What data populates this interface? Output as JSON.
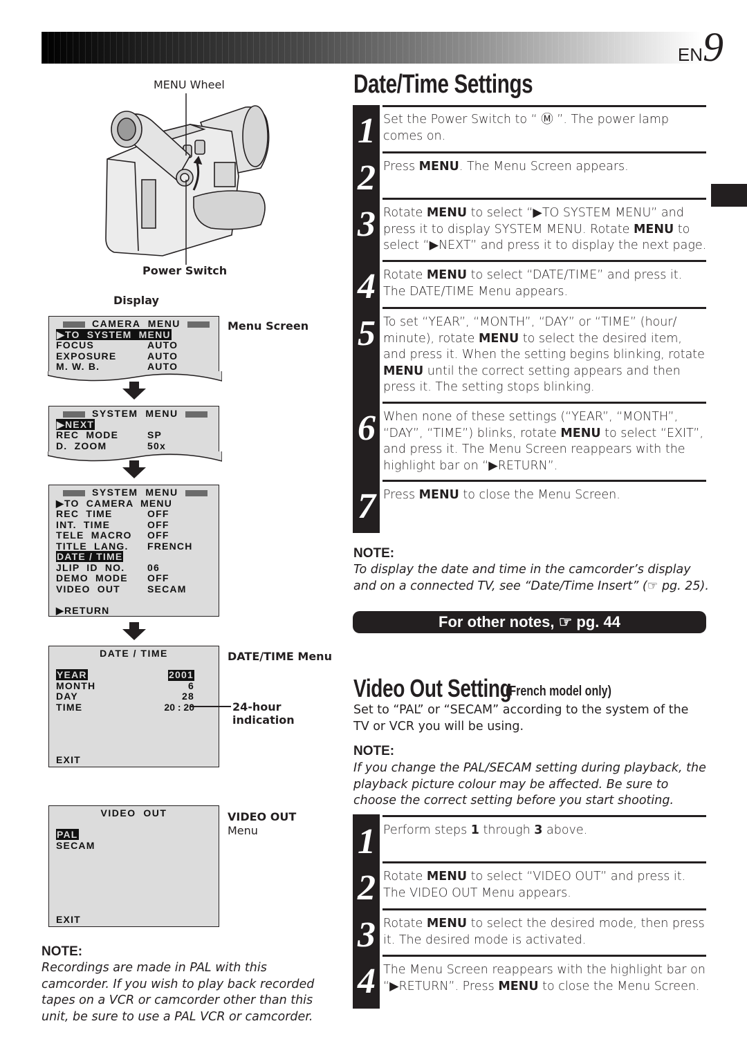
{
  "header": {
    "page_prefix": "EN",
    "page_number": "9"
  },
  "illustration": {
    "menu_wheel_label": "MENU Wheel",
    "power_switch_label": "Power Switch",
    "display_label": "Display"
  },
  "screens": {
    "menu_screen_label": "Menu Screen",
    "camera_menu": {
      "title": "CAMERA  MENU",
      "rows": [
        {
          "label": "▶TO  SYSTEM  MENU",
          "value": "",
          "highlight": true
        },
        {
          "label": "FOCUS",
          "value": "AUTO"
        },
        {
          "label": "EXPOSURE",
          "value": "AUTO"
        },
        {
          "label": "M. W. B.",
          "value": "AUTO"
        }
      ]
    },
    "system_menu_1": {
      "title": "SYSTEM  MENU",
      "rows": [
        {
          "label": "▶NEXT",
          "value": "",
          "highlight": true
        },
        {
          "label": "REC  MODE",
          "value": "SP"
        },
        {
          "label": "D.  ZOOM",
          "value": "50x"
        }
      ]
    },
    "system_menu_2": {
      "title": "SYSTEM  MENU",
      "rows": [
        {
          "label": "▶TO  CAMERA  MENU",
          "value": ""
        },
        {
          "label": "REC  TIME",
          "value": "OFF"
        },
        {
          "label": "INT.  TIME",
          "value": "OFF"
        },
        {
          "label": "TELE  MACRO",
          "value": "OFF"
        },
        {
          "label": "TITLE  LANG.",
          "value": "FRENCH"
        },
        {
          "label": "DATE / TIME",
          "value": "",
          "highlight": true
        },
        {
          "label": "JLIP  ID  NO.",
          "value": "06"
        },
        {
          "label": "DEMO  MODE",
          "value": "OFF"
        },
        {
          "label": "VIDEO  OUT",
          "value": "SECAM"
        }
      ],
      "footer": "▶RETURN"
    },
    "date_time_menu": {
      "label": "DATE/TIME Menu",
      "title": "DATE / TIME",
      "rows": [
        {
          "label": "YEAR",
          "value": "2001",
          "highlight": true
        },
        {
          "label": "MONTH",
          "value": "6"
        },
        {
          "label": "DAY",
          "value": "28"
        },
        {
          "label": "TIME",
          "value": "20 : 20"
        }
      ],
      "exit": "EXIT",
      "callout_line1": "24-hour",
      "callout_line2": "indication"
    },
    "video_out_menu": {
      "label_line1": "VIDEO OUT",
      "label_line2": "Menu",
      "title": "VIDEO  OUT",
      "options": [
        {
          "label": "PAL",
          "highlight": true
        },
        {
          "label": "SECAM"
        }
      ],
      "exit": "EXIT"
    }
  },
  "left_note": {
    "label": "NOTE:",
    "text": "Recordings are made in PAL with this camcorder. If you wish to play back recorded tapes on a VCR or camcorder other than this unit, be sure to use a PAL VCR or camcorder."
  },
  "date_time_section": {
    "title": "Date/Time Settings",
    "steps": [
      {
        "num": "1",
        "html": "Set the Power Switch to “ Ⓜ ”. The power lamp comes on."
      },
      {
        "num": "2",
        "html": "Press <b>MENU</b>. The Menu Screen appears."
      },
      {
        "num": "3",
        "html": "Rotate <b>MENU</b> to select “▶TO SYSTEM MENU” and press it to display SYSTEM MENU. Rotate <b>MENU</b> to select “▶NEXT” and press it to display the next page."
      },
      {
        "num": "4",
        "html": "Rotate <b>MENU</b> to select “DATE/TIME” and press it. The DATE/TIME Menu appears."
      },
      {
        "num": "5",
        "html": "To set “YEAR”, “MONTH”, “DAY” or “TIME” (hour/ minute), rotate <b>MENU</b> to select the desired item, and press it. When the setting begins blinking, rotate <b>MENU</b> until the correct setting appears and then press it. The setting stops blinking."
      },
      {
        "num": "6",
        "html": "When none of these settings (“YEAR”, “MONTH”, “DAY”, “TIME”) blinks, rotate <b>MENU</b> to select “EXIT”, and press it. The Menu Screen reappears with the highlight bar on “▶RETURN”."
      },
      {
        "num": "7",
        "html": "Press <b>MENU</b> to close the Menu Screen."
      }
    ],
    "note_label": "NOTE:",
    "note_text": "To display the date and time in the camcorder’s display and on a connected TV, see “Date/Time Insert” (☞ pg. 25).",
    "other_notes": "For other notes, ☞ pg. 44"
  },
  "video_out_section": {
    "title": "Video Out Setting",
    "subtitle": "(French model only)",
    "intro": "Set to “PAL” or “SECAM” according to the system of the TV or VCR you will be using.",
    "note_label": "NOTE:",
    "note_text": "If you change the PAL/SECAM setting during playback, the playback picture colour may be affected. Be sure to choose the correct setting before you start shooting.",
    "steps": [
      {
        "num": "1",
        "html": "Perform steps <b>1</b> through <b>3</b> above."
      },
      {
        "num": "2",
        "html": "Rotate <b>MENU</b> to select “VIDEO OUT” and press it. The VIDEO OUT Menu appears."
      },
      {
        "num": "3",
        "html": "Rotate <b>MENU</b> to select the desired mode, then press it. The desired mode is activated."
      },
      {
        "num": "4",
        "html": "The Menu Screen reappears with the highlight bar on “▶RETURN”. Press <b>MENU</b> to close the Menu Screen."
      }
    ]
  }
}
